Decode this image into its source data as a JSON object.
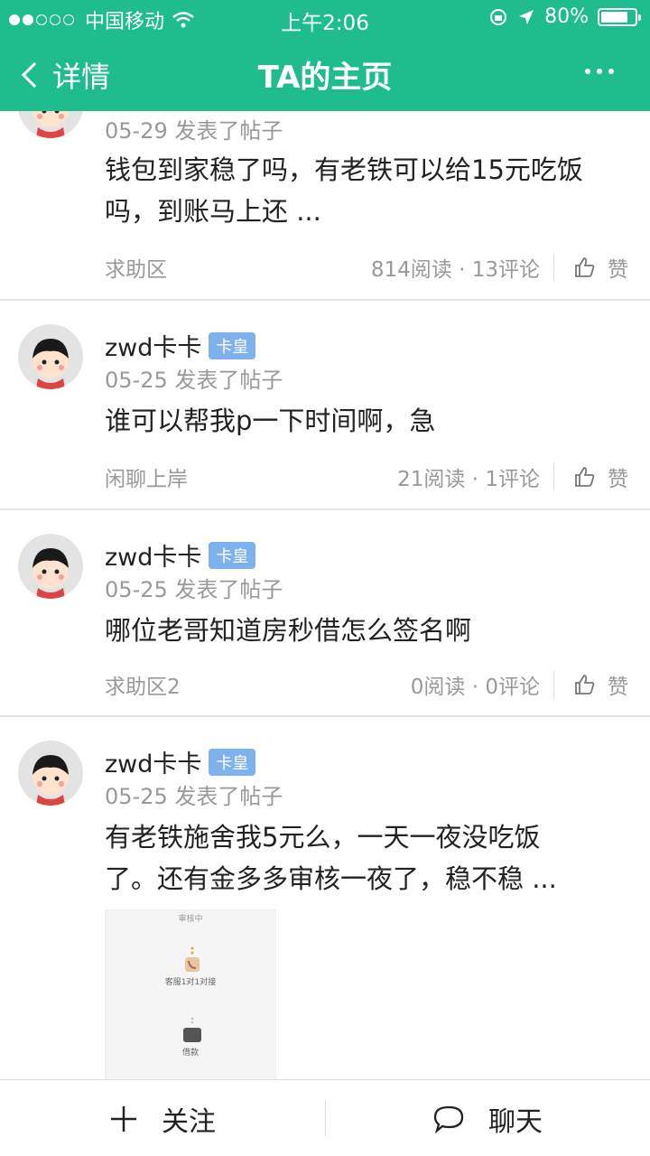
{
  "status_bar": {
    "carrier": "中国移动",
    "time": "上午2:06",
    "battery": "80%",
    "battery_level": 0.8
  },
  "nav": {
    "back_label": "详情",
    "title": "TA的主页"
  },
  "badge_label": "卡皇",
  "posts": [
    {
      "meta": "05-29 发表了帖子",
      "content": "钱包到家稳了吗，有老铁可以给15元吃饭吗，到账马上还 ...",
      "category": "求助区",
      "stats": "814阅读 · 13评论",
      "like": "赞"
    },
    {
      "username": "zwd卡卡",
      "meta": "05-25 发表了帖子",
      "content": "谁可以帮我p一下时间啊，急",
      "category": "闲聊上岸",
      "stats": "21阅读 · 1评论",
      "like": "赞"
    },
    {
      "username": "zwd卡卡",
      "meta": "05-25 发表了帖子",
      "content": "哪位老哥知道房秒借怎么签名啊",
      "category": "求助区2",
      "stats": "0阅读 · 0评论",
      "like": "赞"
    },
    {
      "username": "zwd卡卡",
      "meta": "05-25 发表了帖子",
      "content": "有老铁施舍我5元么，一天一夜没吃饭了。还有金多多审核一夜了，稳不稳 ...",
      "image_texts": [
        "审核中",
        "客服1对1对接",
        "借款"
      ]
    }
  ],
  "bottom_bar": {
    "follow_label": "关注",
    "chat_label": "聊天"
  },
  "colors": {
    "brand": "#1fbd8e",
    "badge": "#7fb1ee"
  }
}
